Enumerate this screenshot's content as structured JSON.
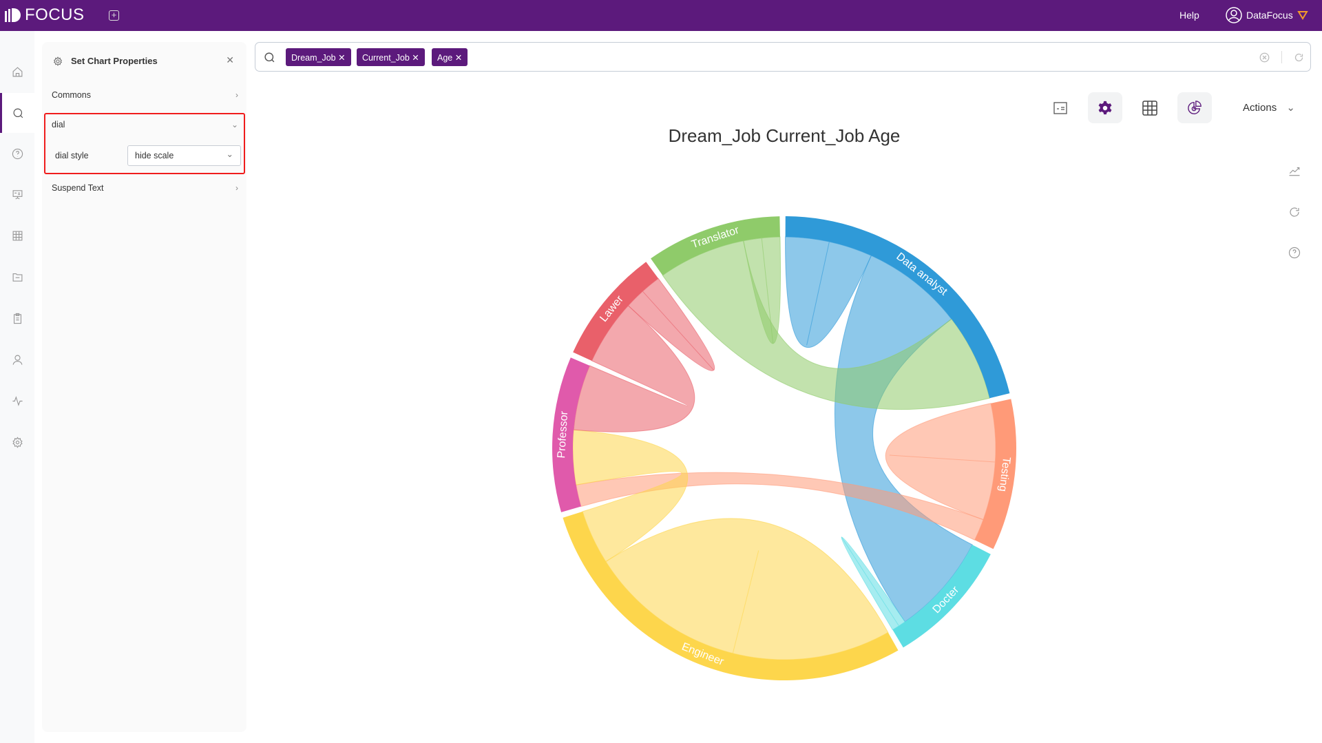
{
  "app": {
    "logo": "FOCUS",
    "help": "Help",
    "user": "DataFocus",
    "icons": {
      "new_tab": "plus-square-icon",
      "user": "user-circle-icon",
      "badge": "diamond-icon"
    }
  },
  "nav": {
    "items": [
      "home-icon",
      "search-icon",
      "help-icon",
      "presentation-icon",
      "table-icon",
      "folder-icon",
      "clipboard-icon",
      "user-icon",
      "pulse-icon",
      "settings-icon"
    ],
    "active": 1
  },
  "panel": {
    "title": "Set Chart Properties",
    "sections": {
      "commons": "Commons",
      "dial": "dial",
      "dial_style_label": "dial style",
      "dial_style_value": "hide scale",
      "suspend": "Suspend Text"
    }
  },
  "search": {
    "chips": [
      "Dream_Job",
      "Current_Job",
      "Age"
    ]
  },
  "toolbar": {
    "actions": "Actions"
  },
  "chart_data": {
    "type": "chord",
    "title": "Dream_Job Current_Job Age",
    "groups": [
      {
        "name": "Data analyst",
        "color": "#2f9ad8",
        "value": 76
      },
      {
        "name": "Testing",
        "color": "#ff9a78",
        "value": 38
      },
      {
        "name": "Docter",
        "color": "#5ddde3",
        "value": 32
      },
      {
        "name": "Engineer",
        "color": "#fdd64c",
        "value": 102
      },
      {
        "name": "Professor",
        "color": "#e05aab",
        "value": 39
      },
      {
        "name": "Lawer",
        "color": "#e9606a",
        "value": 29
      },
      {
        "name": "Translator",
        "color": "#8fcb6a",
        "value": 34
      }
    ],
    "links": [
      {
        "source": "Data analyst",
        "target": "Data analyst",
        "value": 12
      },
      {
        "source": "Data analyst",
        "target": "Docter",
        "value": 28
      },
      {
        "source": "Translator",
        "target": "Data analyst",
        "value": 24
      },
      {
        "source": "Testing",
        "target": "Testing",
        "value": 16
      },
      {
        "source": "Testing",
        "target": "Professor",
        "value": 6
      },
      {
        "source": "Docter",
        "target": "Docter",
        "value": 2
      },
      {
        "source": "Engineer",
        "target": "Engineer",
        "value": 43.5
      },
      {
        "source": "Engineer",
        "target": "Professor",
        "value": 15
      },
      {
        "source": "Lawer",
        "target": "Professor",
        "value": 18
      },
      {
        "source": "Lawer",
        "target": "Lawer",
        "value": 5.5
      },
      {
        "source": "Translator",
        "target": "Translator",
        "value": 5
      }
    ]
  }
}
